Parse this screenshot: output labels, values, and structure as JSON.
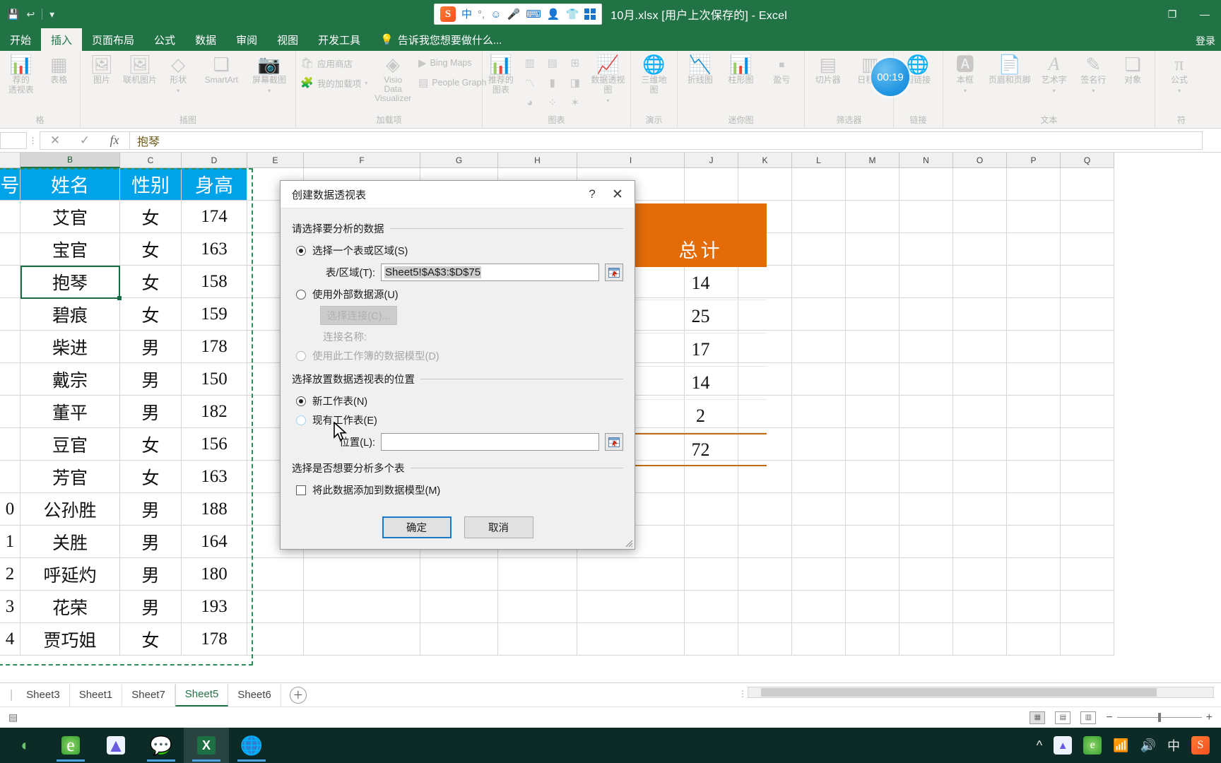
{
  "window": {
    "title": "10月.xlsx [用户上次保存的] - Excel",
    "signin": "登录",
    "minimize": "—",
    "restore": "❐",
    "close": "✕",
    "recording_timer": "00:19"
  },
  "quick_access": {
    "save": "💾",
    "undo": "↩",
    "redo": "↪",
    "customize": "▾"
  },
  "ime": {
    "logo": "S",
    "mode": "中",
    "punct": "°,",
    "emoji": "☺",
    "mic": "🎤",
    "keyboard": "⌨",
    "user": "👤",
    "skin": "👕",
    "apps": "▦"
  },
  "ribbon": {
    "tabs": [
      {
        "label": "开始",
        "active": false
      },
      {
        "label": "插入",
        "active": true
      },
      {
        "label": "页面布局",
        "active": false
      },
      {
        "label": "公式",
        "active": false
      },
      {
        "label": "数据",
        "active": false
      },
      {
        "label": "审阅",
        "active": false
      },
      {
        "label": "视图",
        "active": false
      },
      {
        "label": "开发工具",
        "active": false
      }
    ],
    "tell_me": "告诉我您想要做什么...",
    "groups": [
      {
        "label": "格",
        "items": [
          {
            "label": "荐的\n透视表",
            "icon": "pivot-recommend-icon"
          },
          {
            "label": "表格",
            "icon": "table-icon"
          }
        ]
      },
      {
        "label": "插图",
        "items": [
          {
            "label": "图片",
            "icon": "picture-icon"
          },
          {
            "label": "联机图片",
            "icon": "online-picture-icon"
          },
          {
            "label": "形状",
            "icon": "shapes-icon"
          },
          {
            "label": "SmartArt",
            "icon": "smartart-icon"
          },
          {
            "label": "屏幕截图",
            "icon": "screenshot-icon"
          }
        ]
      },
      {
        "label": "加载项",
        "items": [
          {
            "label": "应用商店",
            "icon": "store-icon"
          },
          {
            "label": "我的加载项",
            "icon": "my-addins-icon"
          },
          {
            "label": "Visio Data Visualizer",
            "icon": "visio-icon"
          },
          {
            "label": "Bing Maps",
            "icon": "bing-maps-icon"
          },
          {
            "label": "People Graph",
            "icon": "people-graph-icon"
          }
        ]
      },
      {
        "label": "图表",
        "items": [
          {
            "label": "推荐的\n图表",
            "icon": "recommended-charts-icon"
          },
          {
            "label": "数据透视图",
            "icon": "pivotchart-icon"
          }
        ]
      },
      {
        "label": "演示",
        "items": [
          {
            "label": "三维地\n图",
            "icon": "3d-map-icon"
          }
        ]
      },
      {
        "label": "迷你图",
        "items": [
          {
            "label": "折线图",
            "icon": "sparkline-line-icon"
          },
          {
            "label": "柱形图",
            "icon": "sparkline-column-icon"
          },
          {
            "label": "盈亏",
            "icon": "sparkline-winloss-icon"
          }
        ]
      },
      {
        "label": "筛选器",
        "items": [
          {
            "label": "切片器",
            "icon": "slicer-icon"
          },
          {
            "label": "日程表",
            "icon": "timeline-icon"
          }
        ]
      },
      {
        "label": "链接",
        "items": [
          {
            "label": "超链接",
            "icon": "hyperlink-icon"
          }
        ]
      },
      {
        "label": "文本",
        "items": [
          {
            "label": "本框",
            "icon": "textbox-icon"
          },
          {
            "label": "页眉和页脚",
            "icon": "header-footer-icon"
          },
          {
            "label": "艺术字",
            "icon": "wordart-icon"
          },
          {
            "label": "签名行",
            "icon": "signature-line-icon"
          },
          {
            "label": "对象",
            "icon": "object-icon"
          }
        ]
      },
      {
        "label": "符",
        "items": [
          {
            "label": "公式",
            "icon": "equation-icon"
          }
        ]
      }
    ]
  },
  "formula_bar": {
    "name_box": "",
    "cancel": "✕",
    "enter": "✓",
    "fx": "fx",
    "value": "抱琴"
  },
  "grid": {
    "columns": [
      "B",
      "C",
      "D",
      "E",
      "F",
      "G",
      "H",
      "I",
      "J",
      "K",
      "L",
      "M",
      "N",
      "O",
      "P",
      "Q"
    ],
    "selected_column": "B",
    "headers": [
      "号",
      "姓名",
      "性别",
      "身高"
    ],
    "rows": [
      {
        "id": "",
        "name": "艾官",
        "gender": "女",
        "height": "174"
      },
      {
        "id": "",
        "name": "宝官",
        "gender": "女",
        "height": "163"
      },
      {
        "id": "",
        "name": "抱琴",
        "gender": "女",
        "height": "158"
      },
      {
        "id": "",
        "name": "碧痕",
        "gender": "女",
        "height": "159"
      },
      {
        "id": "",
        "name": "柴进",
        "gender": "男",
        "height": "178"
      },
      {
        "id": "",
        "name": "戴宗",
        "gender": "男",
        "height": "150"
      },
      {
        "id": "",
        "name": "董平",
        "gender": "男",
        "height": "182"
      },
      {
        "id": "",
        "name": "豆官",
        "gender": "女",
        "height": "156"
      },
      {
        "id": "",
        "name": "芳官",
        "gender": "女",
        "height": "163"
      },
      {
        "id": "0",
        "name": "公孙胜",
        "gender": "男",
        "height": "188"
      },
      {
        "id": "1",
        "name": "关胜",
        "gender": "男",
        "height": "164"
      },
      {
        "id": "2",
        "name": "呼延灼",
        "gender": "男",
        "height": "180"
      },
      {
        "id": "3",
        "name": "花荣",
        "gender": "男",
        "height": "193"
      },
      {
        "id": "4",
        "name": "贾巧姐",
        "gender": "女",
        "height": "178"
      }
    ]
  },
  "pivot": {
    "header": "总计",
    "values": [
      "14",
      "25",
      "17",
      "14",
      "2"
    ],
    "grand_total": "72"
  },
  "dialog": {
    "title": "创建数据透视表",
    "help": "?",
    "close": "✕",
    "section1": "请选择要分析的数据",
    "option_table_range": "选择一个表或区域(S)",
    "label_range": "表/区域(T):",
    "range_value": "Sheet5!$A$3:$D$75",
    "option_external": "使用外部数据源(U)",
    "btn_choose_connection": "选择连接(C)...",
    "label_connection_name": "连接名称:",
    "option_data_model": "使用此工作簿的数据模型(D)",
    "section2": "选择放置数据透视表的位置",
    "option_new_sheet": "新工作表(N)",
    "option_existing_sheet": "现有工作表(E)",
    "label_location": "位置(L):",
    "location_value": "",
    "section3": "选择是否想要分析多个表",
    "checkbox_add_to_model": "将此数据添加到数据模型(M)",
    "btn_ok": "确定",
    "btn_cancel": "取消"
  },
  "sheet_tabs": {
    "tabs": [
      {
        "label": "Sheet3",
        "active": false
      },
      {
        "label": "Sheet1",
        "active": false
      },
      {
        "label": "Sheet7",
        "active": false
      },
      {
        "label": "Sheet5",
        "active": true
      },
      {
        "label": "Sheet6",
        "active": false
      }
    ],
    "add": "＋"
  },
  "status_bar": {
    "left_icon": "▤",
    "view_normal": "▦",
    "view_layout": "▤",
    "view_break": "▥",
    "zoom_out": "−",
    "zoom_in": "+"
  },
  "taskbar": {
    "items": [
      {
        "name": "ie-browser",
        "glyph": "e"
      },
      {
        "name": "thunder-app",
        "glyph": "⚡"
      },
      {
        "name": "wechat",
        "glyph": "💬"
      },
      {
        "name": "excel",
        "glyph": "X"
      },
      {
        "name": "browser-globe",
        "glyph": "🌐"
      }
    ],
    "tray": [
      "^",
      "⚡",
      "e",
      "📶",
      "🔊",
      "中",
      "S"
    ]
  },
  "colors": {
    "excel_green": "#217346",
    "header_blue": "#00a2e8",
    "pivot_orange": "#e36c09",
    "accent_blue": "#1a79c7"
  }
}
